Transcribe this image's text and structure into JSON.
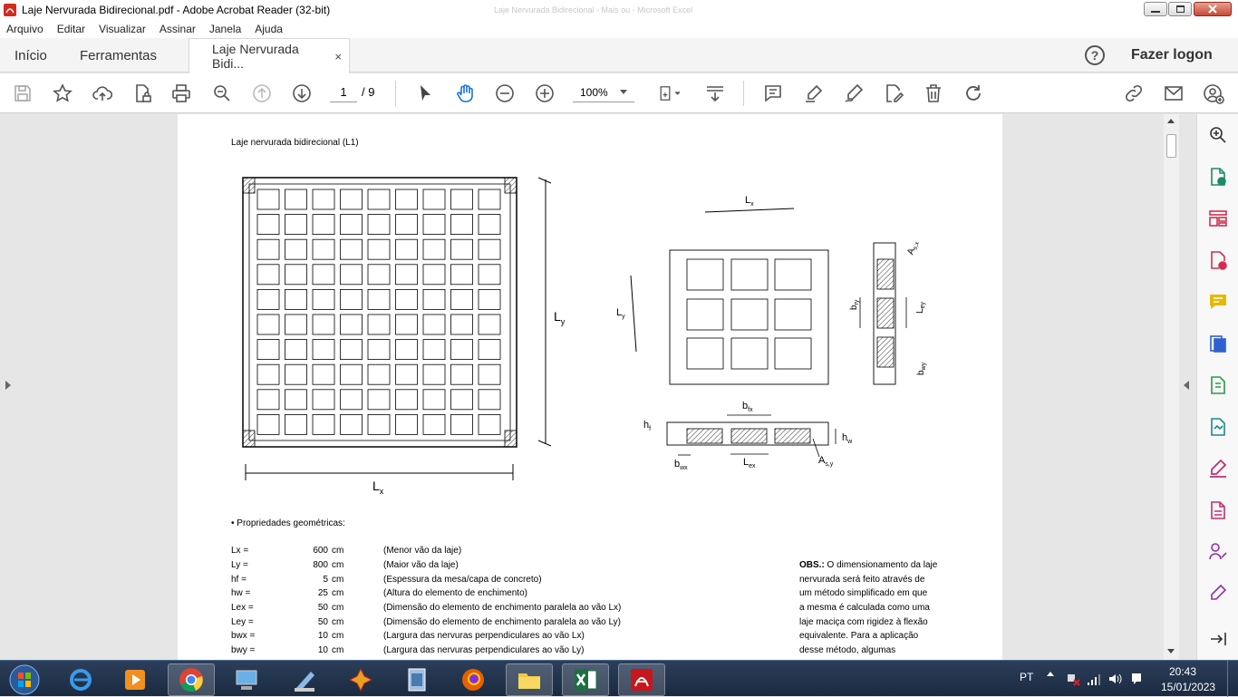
{
  "window": {
    "title": "Laje Nervurada Bidirecional.pdf - Adobe Acrobat Reader (32-bit)",
    "ghost_title": "Laje Nervurada Bidirecional - Mais ou - Microsoft Excel"
  },
  "menu": [
    "Arquivo",
    "Editar",
    "Visualizar",
    "Assinar",
    "Janela",
    "Ajuda"
  ],
  "tabs": {
    "home": "Início",
    "tools": "Ferramentas",
    "doc": "Laje Nervurada Bidi...",
    "close": "×"
  },
  "header": {
    "help": "?",
    "login": "Fazer logon"
  },
  "toolbar": {
    "page_current": "1",
    "page_total": "/ 9",
    "zoom": "100%"
  },
  "document": {
    "heading": "Laje nervurada bidirecional (L1)",
    "section": "• Propriedades geométricas:",
    "fig_labels": {
      "Ly_big": "L",
      "Ly_big_sub": "y",
      "Lx_big": "L",
      "Lx_big_sub": "x",
      "lx": "L",
      "lx_sub": "x",
      "ly": "L",
      "ly_sub": "y",
      "asx": "A",
      "asx_sub": "s,x",
      "bry": "b",
      "bry_sub": "ry",
      "ley": "L",
      "ley_sub": "ey",
      "bwy": "b",
      "bwy_sub": "wy",
      "bfx": "b",
      "bfx_sub": "fx",
      "hf": "h",
      "hf_sub": "f",
      "hw": "h",
      "hw_sub": "w",
      "bwx": "b",
      "bwx_sub": "wx",
      "lex": "L",
      "lex_sub": "ex",
      "asy": "A",
      "asy_sub": "s,y"
    },
    "props": [
      {
        "name": "Lx =",
        "value": "600",
        "unit": "cm",
        "desc": "(Menor vão da laje)"
      },
      {
        "name": "Ly =",
        "value": "800",
        "unit": "cm",
        "desc": "(Maior vão da laje)"
      },
      {
        "name": "hf =",
        "value": "5",
        "unit": "cm",
        "desc": "(Espessura da mesa/capa de concreto)"
      },
      {
        "name": "hw =",
        "value": "25",
        "unit": "cm",
        "desc": "(Altura do elemento de enchimento)"
      },
      {
        "name": "Lex =",
        "value": "50",
        "unit": "cm",
        "desc": "(Dimensão do elemento de enchimento paralela ao vão Lx)"
      },
      {
        "name": "Ley =",
        "value": "50",
        "unit": "cm",
        "desc": "(Dimensão do elemento de enchimento paralela ao vão Ly)"
      },
      {
        "name": "bwx =",
        "value": "10",
        "unit": "cm",
        "desc": "(Largura das nervuras perpendiculares ao vão Lx)"
      },
      {
        "name": "bwy =",
        "value": "10",
        "unit": "cm",
        "desc": "(Largura das nervuras perpendiculares ao vão Ly)"
      }
    ],
    "obs_label": "OBS.:",
    "obs_lines": [
      " O dimensionamento da laje",
      "nervurada será feito através de",
      "um método simplificado em que",
      "a mesma é calculada como uma",
      "laje maciça com rigidez à flexão",
      "equivalente. Para a aplicação",
      "desse método, algumas"
    ]
  },
  "taskbar": {
    "lang": "PT",
    "time": "20:43",
    "date": "15/01/2023"
  }
}
